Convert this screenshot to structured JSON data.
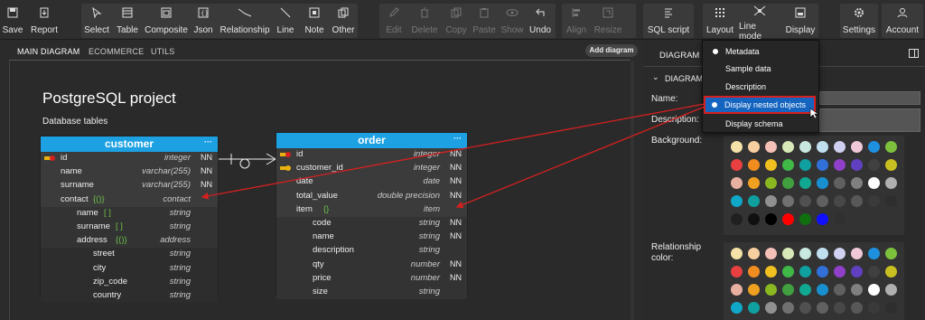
{
  "toolbar": {
    "save": "Save",
    "report": "Report",
    "select": "Select",
    "table": "Table",
    "composite": "Composite",
    "json": "Json",
    "relationship": "Relationship",
    "line": "Line",
    "note": "Note",
    "other": "Other",
    "edit": "Edit",
    "delete": "Delete",
    "copy": "Copy",
    "paste": "Paste",
    "show": "Show",
    "undo": "Undo",
    "align": "Align",
    "resize": "Resize",
    "sql_script": "SQL script",
    "layout": "Layout",
    "line_mode": "Line mode",
    "display": "Display",
    "settings": "Settings",
    "account": "Account"
  },
  "tabs": {
    "main": "MAIN DIAGRAM",
    "ecommerce": "ECOMMERCE",
    "utils": "UTILS",
    "add": "Add diagram"
  },
  "project": {
    "title": "PostgreSQL project",
    "subtitle": "Database tables"
  },
  "customer": {
    "name": "customer",
    "dots": "···",
    "rows": [
      {
        "n": "id",
        "t": "integer",
        "nn": "NN"
      },
      {
        "n": "name",
        "t": "varchar(255)",
        "nn": "NN"
      },
      {
        "n": "surname",
        "t": "varchar(255)",
        "nn": "NN"
      },
      {
        "n": "contact",
        "b": "{()}",
        "t": "contact",
        "nn": ""
      },
      {
        "n": "name",
        "b": "[ ]",
        "t": "string",
        "nn": ""
      },
      {
        "n": "surname",
        "b": "[ ]",
        "t": "string",
        "nn": ""
      },
      {
        "n": "address",
        "b": "{()}",
        "t": "address",
        "nn": ""
      },
      {
        "n": "street",
        "t": "string",
        "nn": ""
      },
      {
        "n": "city",
        "t": "string",
        "nn": ""
      },
      {
        "n": "zip_code",
        "t": "string",
        "nn": ""
      },
      {
        "n": "country",
        "t": "string",
        "nn": ""
      }
    ]
  },
  "order": {
    "name": "order",
    "dots": "···",
    "rows": [
      {
        "n": "id",
        "t": "integer",
        "nn": "NN"
      },
      {
        "n": "customer_id",
        "t": "integer",
        "nn": "NN"
      },
      {
        "n": "date",
        "t": "date",
        "nn": "NN"
      },
      {
        "n": "total_value",
        "t": "double precision",
        "nn": "NN"
      },
      {
        "n": "item",
        "b": "{}",
        "t": "item",
        "nn": ""
      },
      {
        "n": "code",
        "t": "string",
        "nn": "NN"
      },
      {
        "n": "name",
        "t": "string",
        "nn": "NN"
      },
      {
        "n": "description",
        "t": "string",
        "nn": ""
      },
      {
        "n": "qty",
        "t": "number",
        "nn": "NN"
      },
      {
        "n": "price",
        "t": "number",
        "nn": "NN"
      },
      {
        "n": "size",
        "t": "string",
        "nn": ""
      }
    ]
  },
  "panel": {
    "title": "DIAGRAM I",
    "section": "DIAGRAM",
    "name_label": "Name:",
    "description_label": "Description:",
    "background_label": "Background:",
    "relationship_label": "Relationship",
    "relationship_label2": "color:"
  },
  "menu": {
    "items": [
      "Metadata",
      "Sample data",
      "Description",
      "Display nested objects",
      "Display schema"
    ]
  },
  "colors": {
    "header": "#1da1e2",
    "menu_highlight": "#1565c0",
    "annotation": "#d62020"
  }
}
